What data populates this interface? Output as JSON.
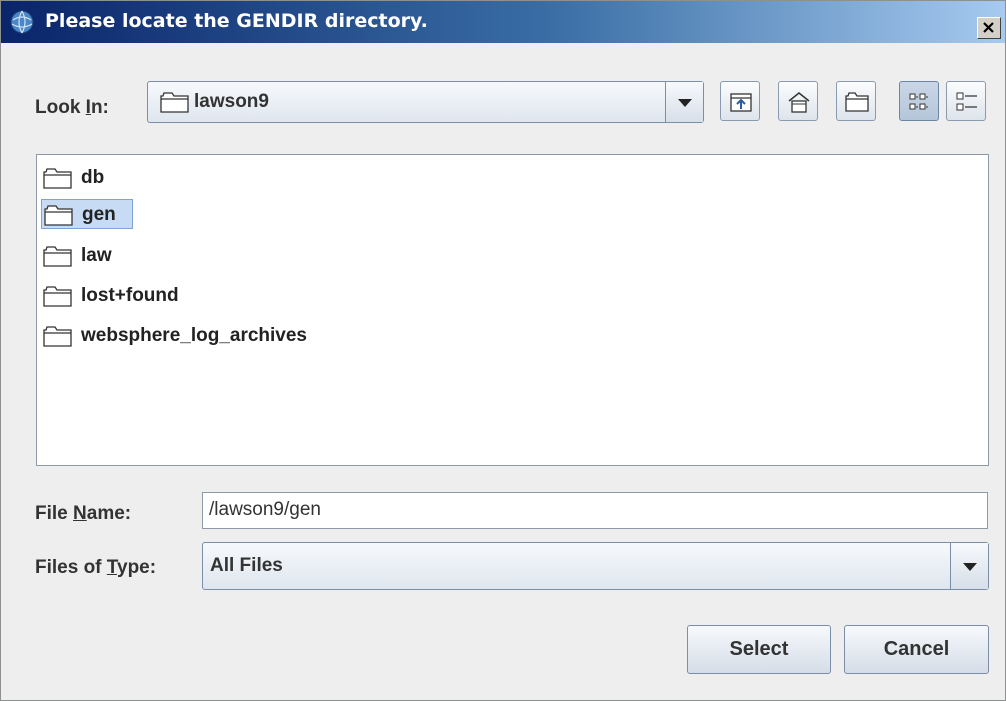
{
  "dialog": {
    "title": "Please locate the GENDIR directory.",
    "close_glyph": "×"
  },
  "look_in": {
    "label_prefix": "Look ",
    "label_mnemonic": "I",
    "label_suffix": "n:",
    "value": "lawson9",
    "icon": "folder-icon"
  },
  "toolbar": {
    "buttons": [
      "up-one-level-icon",
      "home-icon",
      "new-folder-icon",
      "list-view-icon",
      "details-view-icon"
    ]
  },
  "file_list": {
    "items": [
      {
        "name": "db",
        "icon": "folder-icon",
        "selected": false
      },
      {
        "name": "gen",
        "icon": "folder-icon",
        "selected": true
      },
      {
        "name": "law",
        "icon": "folder-icon",
        "selected": false
      },
      {
        "name": "lost+found",
        "icon": "folder-icon",
        "selected": false
      },
      {
        "name": "websphere_log_archives",
        "icon": "folder-icon",
        "selected": false
      }
    ]
  },
  "file_name": {
    "label_prefix": "File ",
    "label_mnemonic": "N",
    "label_suffix": "ame:",
    "value": "/lawson9/gen"
  },
  "files_of_type": {
    "label_prefix": "Files of ",
    "label_mnemonic": "T",
    "label_suffix": "ype:",
    "value": "All Files"
  },
  "buttons": {
    "select": "Select",
    "cancel": "Cancel"
  },
  "colors": {
    "title_start": "#0a246a",
    "title_end": "#a6caf0",
    "selection": "#c8dbf4"
  }
}
